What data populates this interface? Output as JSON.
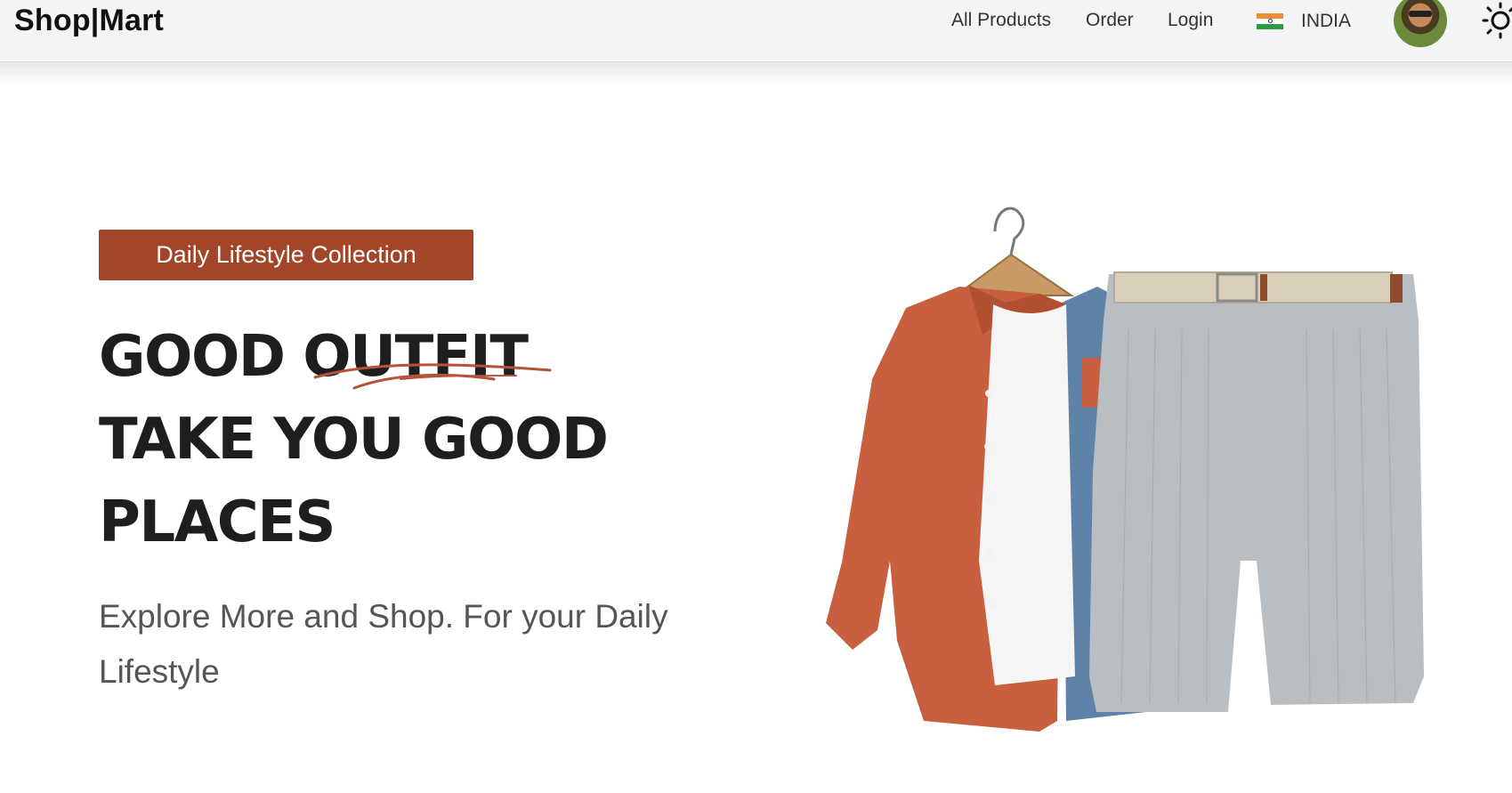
{
  "header": {
    "logo": "Shop|Mart",
    "nav": {
      "all_products": "All Products",
      "order": "Order",
      "login": "Login"
    },
    "country": {
      "flag_icon": "india-flag-icon",
      "label": "INDIA"
    },
    "avatar_icon": "user-avatar",
    "theme_icon": "sun-icon"
  },
  "hero": {
    "badge": "Daily Lifestyle Collection",
    "headline": {
      "line1_a": "GOOD ",
      "line1_b": "OUTFIT",
      "line2": "TAKE YOU GOOD",
      "line3": "PLACES"
    },
    "subtitle": "Explore More and Shop. For your Daily Lifestyle",
    "image_icon": "outfit-product-image"
  },
  "colors": {
    "badge_bg": "#a34529",
    "headline": "#1e1e1e",
    "squiggle": "#b5533a",
    "navbar_bg": "#f3f4f6"
  }
}
